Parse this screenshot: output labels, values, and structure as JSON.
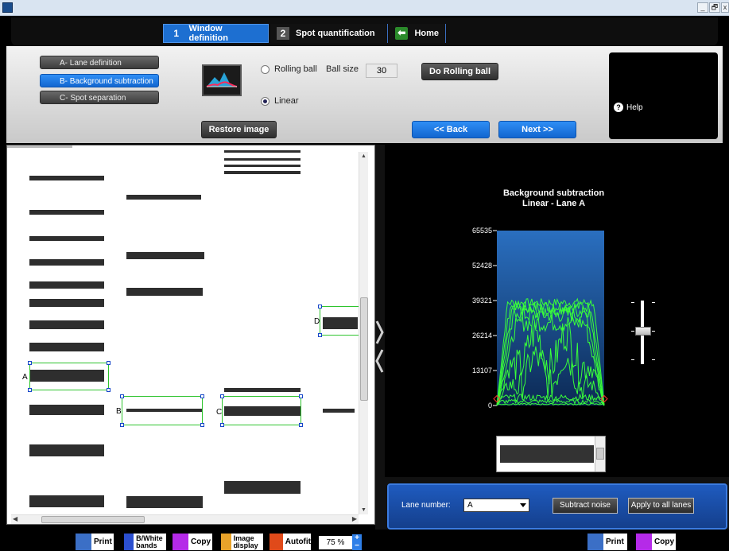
{
  "window": {
    "minimize": "_",
    "restore": "🗗",
    "close": "x"
  },
  "tabs": [
    {
      "num": "1",
      "label": "Window definition"
    },
    {
      "num": "2",
      "label": "Spot quantification"
    },
    {
      "label": "Home"
    }
  ],
  "steps": [
    "A- Lane definition",
    "B- Background subtraction",
    "C- Spot separation"
  ],
  "options": {
    "rolling_ball": "Rolling ball",
    "ball_size_label": "Ball size",
    "ball_size_value": "30",
    "linear": "Linear",
    "selected": "Linear"
  },
  "buttons": {
    "do_rolling_ball": "Do Rolling ball",
    "restore_image": "Restore image",
    "back": "<< Back",
    "next": "Next >>",
    "help": "Help"
  },
  "lanes": [
    "A",
    "B",
    "C",
    "D"
  ],
  "chart_data": {
    "type": "line",
    "title": "Background subtraction",
    "subtitle": "Linear - Lane A",
    "yticks": [
      65535,
      52428,
      39321,
      26214,
      13107,
      0
    ],
    "ylim": [
      0,
      65535
    ],
    "series_color": "#39ff39",
    "background_top": "#2a6fc0",
    "background_bottom": "#0c2a55"
  },
  "lane_panel": {
    "label": "Lane number:",
    "selected": "A",
    "subtract_noise": "Subtract noise",
    "apply_all": "Apply to all lanes"
  },
  "bottom_left": {
    "print": "Print",
    "bw_bands": "B/White bands",
    "copy": "Copy",
    "image_display": "Image display",
    "autofit": "Autofit",
    "zoom": "75 %"
  },
  "bottom_right": {
    "print": "Print",
    "copy": "Copy"
  },
  "colors": {
    "accent_blue": "#1d6fd1",
    "profile_green": "#39ff39",
    "box_green": "#2ec42e"
  }
}
